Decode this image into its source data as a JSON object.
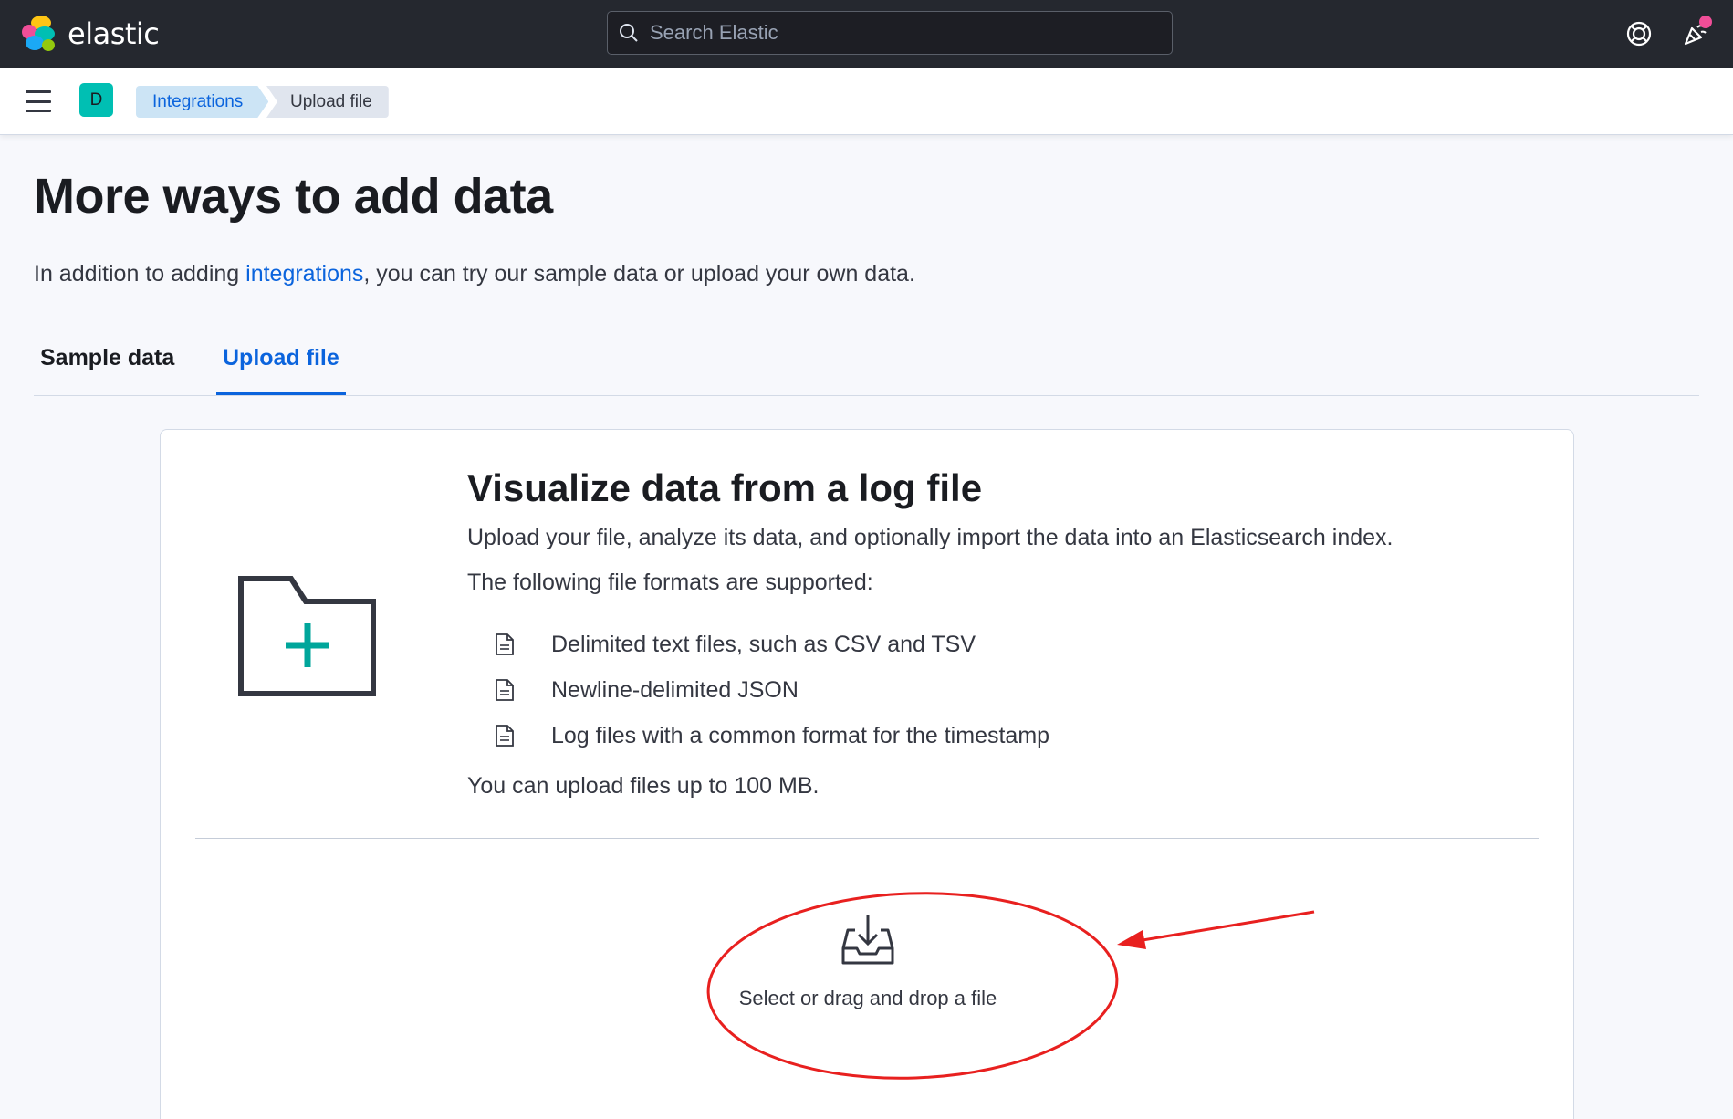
{
  "header": {
    "brand": "elastic",
    "search_placeholder": "Search Elastic",
    "icons": [
      "help-icon",
      "newsfeed-icon"
    ],
    "notification_color": "#f04e98"
  },
  "subheader": {
    "space_initial": "D",
    "breadcrumbs": [
      "Integrations",
      "Upload file"
    ]
  },
  "main": {
    "title": "More ways to add data",
    "intro_before": "In addition to adding ",
    "intro_link": "integrations",
    "intro_after": ", you can try our sample data or upload your own data.",
    "tabs": [
      {
        "label": "Sample data",
        "active": false
      },
      {
        "label": "Upload file",
        "active": true
      }
    ]
  },
  "upload_panel": {
    "title": "Visualize data from a log file",
    "description": "Upload your file, analyze its data, and optionally import the data into an Elasticsearch index.",
    "formats_intro": "The following file formats are supported:",
    "formats": [
      "Delimited text files, such as CSV and TSV",
      "Newline-delimited JSON",
      "Log files with a common format for the timestamp"
    ],
    "size_note": "You can upload files up to 100 MB.",
    "dropzone_label": "Select or drag and drop a file"
  },
  "colors": {
    "accent": "#0b64dd",
    "header_bg": "#25282f",
    "folder_plus": "#00a69b",
    "annotation": "#e8201f"
  }
}
